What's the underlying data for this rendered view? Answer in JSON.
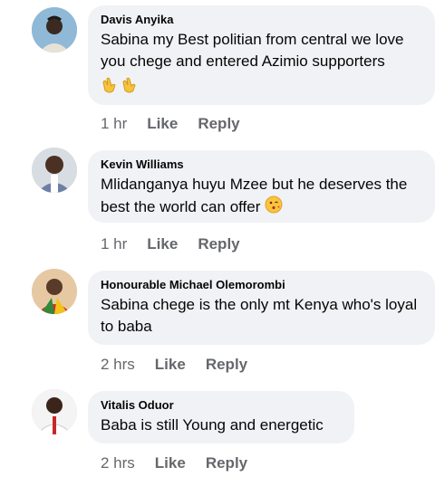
{
  "comments": [
    {
      "author": "Davis Anyika",
      "text": "Sabina my Best politian from central we love you chege and entered Azimio supporters",
      "emoji": [
        "clapping-hands",
        "clapping-hands"
      ],
      "time": "1 hr",
      "like": "Like",
      "reply": "Reply"
    },
    {
      "author": "Kevin Williams",
      "text": "Mlidanganya huyu Mzee but he deserves the best the world can offer",
      "emoji": [
        "kissing-face"
      ],
      "time": "1 hr",
      "like": "Like",
      "reply": "Reply"
    },
    {
      "author": "Honourable Michael Olemorombi",
      "text": "Sabina chege is the only mt Kenya who's loyal to baba",
      "time": "2 hrs",
      "like": "Like",
      "reply": "Reply"
    },
    {
      "author": "Vitalis Oduor",
      "text": "Baba is still Young and energetic",
      "time": "2 hrs",
      "like": "Like",
      "reply": "Reply"
    }
  ]
}
